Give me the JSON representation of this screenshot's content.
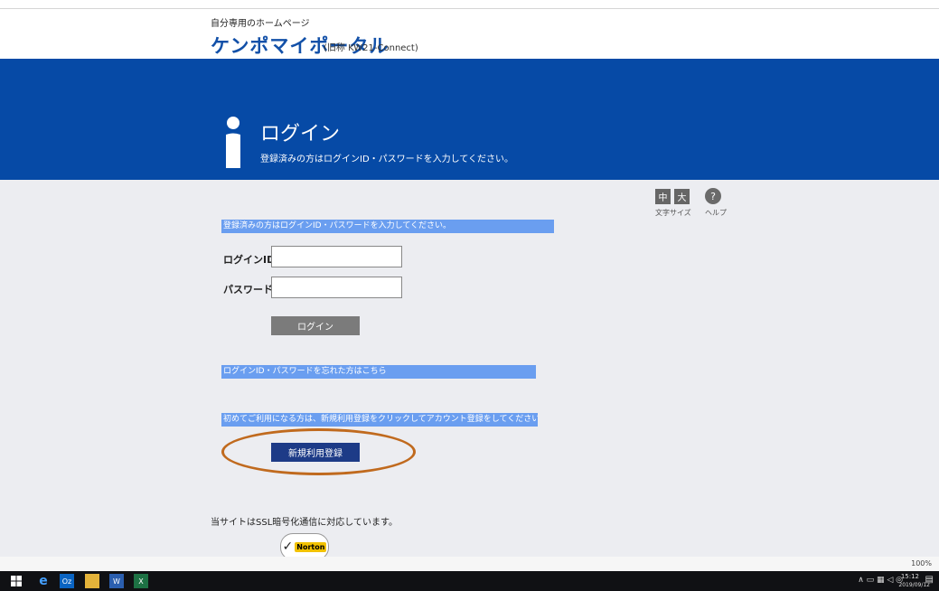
{
  "header": {
    "site_subtitle": "自分専用のホームページ",
    "site_title": "ケンポマイポータル",
    "site_title_note": "(旧称 KW21-Connect)"
  },
  "banner": {
    "title": "ログイン",
    "subtitle": "登録済みの方はログインID・パスワードを入力してください。"
  },
  "font_controls": {
    "medium_label": "中",
    "large_label": "大",
    "font_size_caption": "文字サイズ",
    "help_symbol": "?",
    "help_caption": "ヘルプ"
  },
  "login_form": {
    "instruction": "登録済みの方はログインID・パスワードを入力してください。",
    "login_id_label": "ログインID",
    "login_id_value": "",
    "password_label": "パスワード",
    "password_value": "",
    "login_button": "ログイン"
  },
  "forgot": {
    "text": "ログインID・パスワードを忘れた方はこちら"
  },
  "register": {
    "instruction": "初めてご利用になる方は、新規利用登録をクリックしてアカウント登録をしてください。",
    "button": "新規利用登録"
  },
  "footer": {
    "ssl_text": "当サイトはSSL暗号化通信に対応しています。",
    "norton_text": "Norton"
  },
  "browser_status": {
    "zoom": "100%"
  },
  "taskbar": {
    "ie_glyph": "e",
    "outlook_glyph": "Oz",
    "word_glyph": "W",
    "excel_glyph": "X",
    "time": "15:12",
    "date": "2019/09/12"
  },
  "colors": {
    "banner": "#064aa6",
    "info_bar": "#6a9ef0",
    "register_button": "#1d3b87",
    "highlight_ellipse": "#c06a1e"
  }
}
